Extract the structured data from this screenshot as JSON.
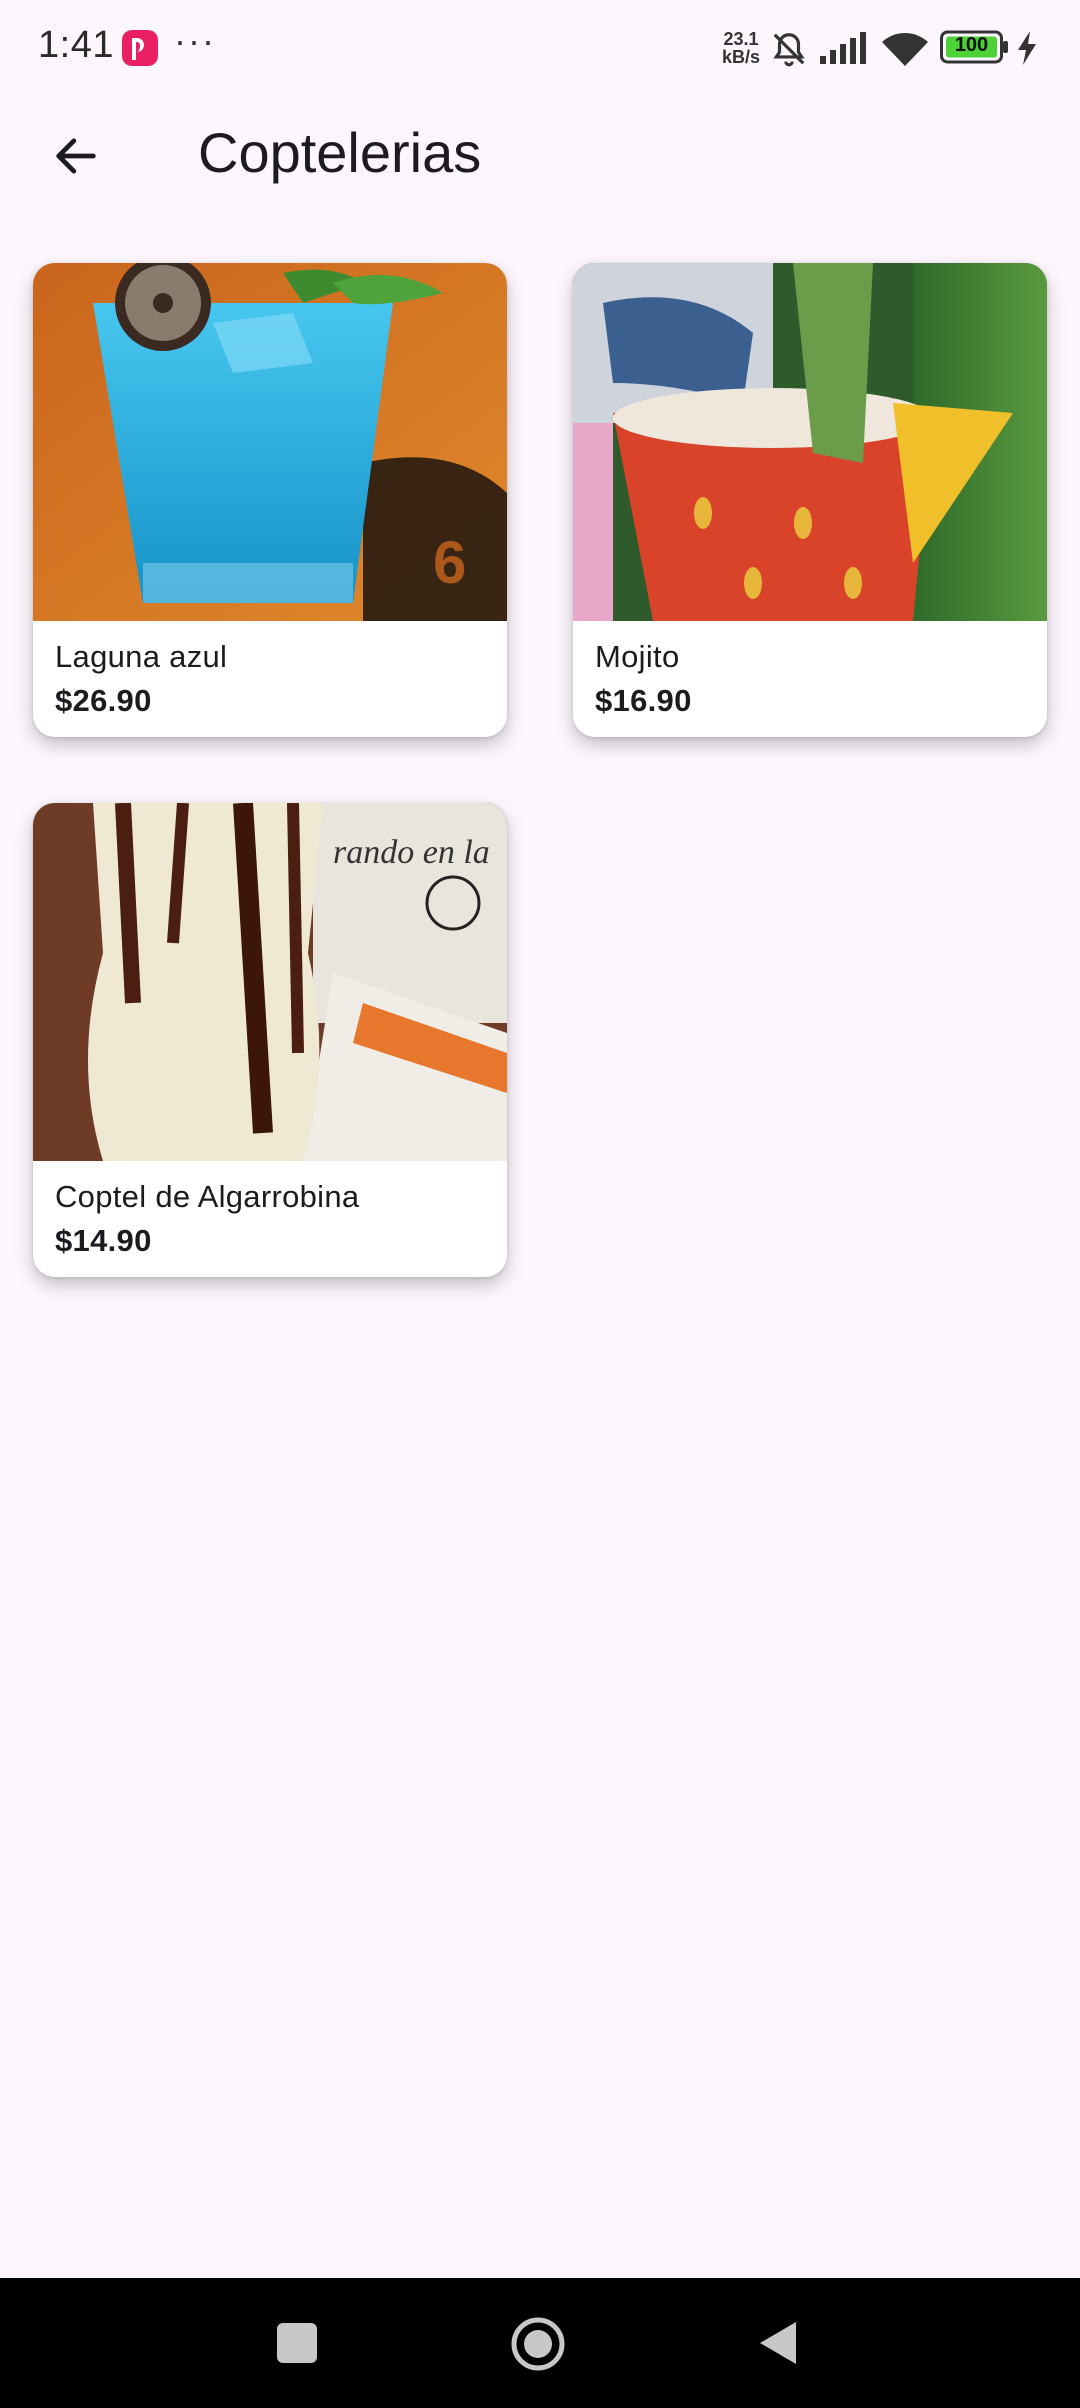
{
  "status_bar": {
    "time": "1:41",
    "dots": "···",
    "net_speed_value": "23.1",
    "net_speed_unit": "kB/s",
    "battery_level": "100"
  },
  "app_bar": {
    "title": "Coptelerias"
  },
  "products": [
    {
      "name": "Laguna azul",
      "price": "$26.90"
    },
    {
      "name": "Mojito",
      "price": "$16.90"
    },
    {
      "name": "Coptel de Algarrobina",
      "price": "$14.90"
    }
  ],
  "colors": {
    "background": "#fdf6fd",
    "card": "#ffffff",
    "text": "#1d1b20",
    "nav_bar": "#000000",
    "battery_fill": "#4cd137"
  },
  "icons": {
    "back": "arrow-left-icon",
    "recents": "square-icon",
    "home": "circle-icon",
    "nav_back": "triangle-back-icon"
  }
}
